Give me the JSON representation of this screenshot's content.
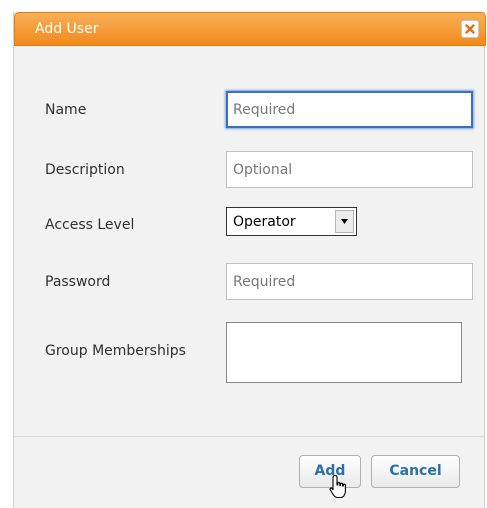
{
  "dialog": {
    "title": "Add User",
    "close_icon": "close-icon"
  },
  "form": {
    "name": {
      "label": "Name",
      "placeholder": "Required"
    },
    "description": {
      "label": "Description",
      "placeholder": "Optional"
    },
    "access_level": {
      "label": "Access Level",
      "value": "Operator"
    },
    "password": {
      "label": "Password",
      "placeholder": "Required"
    },
    "group_memberships": {
      "label": "Group Memberships"
    }
  },
  "buttons": {
    "add": "Add",
    "cancel": "Cancel"
  },
  "colors": {
    "titlebar": "#f08a1a",
    "accent_text": "#2b6fa8",
    "focus_border": "#3a70c4"
  }
}
